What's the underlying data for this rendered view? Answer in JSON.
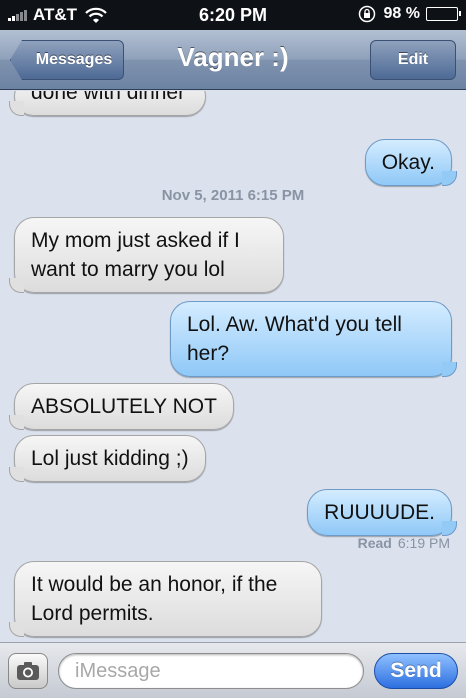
{
  "status_bar": {
    "carrier": "AT&T",
    "time": "6:20 PM",
    "battery_percent": "98 %",
    "battery_level": 0.98
  },
  "nav": {
    "back_label": "Messages",
    "title": "Vagner :)",
    "edit_label": "Edit"
  },
  "messages": [
    {
      "from": "them",
      "text": "done with dinner"
    },
    {
      "from": "me",
      "text": "Okay."
    },
    {
      "from": "them",
      "text": "My mom just asked if I want to marry you lol"
    },
    {
      "from": "me",
      "text": "Lol. Aw. What'd you tell her?"
    },
    {
      "from": "them",
      "text": "ABSOLUTELY NOT"
    },
    {
      "from": "them",
      "text": "Lol just kidding ;)"
    },
    {
      "from": "me",
      "text": "RUUUUDE."
    },
    {
      "from": "them",
      "text": "It would be an honor, if the Lord permits."
    }
  ],
  "timestamp": "Nov 5, 2011 6:15 PM",
  "read_receipt": {
    "label": "Read",
    "time": "6:19 PM"
  },
  "input": {
    "placeholder": "iMessage",
    "value": "",
    "send_label": "Send"
  },
  "icons": {
    "camera": "camera-icon",
    "wifi": "wifi-icon",
    "lock": "rotation-lock-icon",
    "signal": "signal-bars-icon"
  },
  "colors": {
    "incoming_bubble": "#e8e8e8",
    "outgoing_bubble": "#a9d5fb",
    "send_button": "#3f7fe6"
  }
}
